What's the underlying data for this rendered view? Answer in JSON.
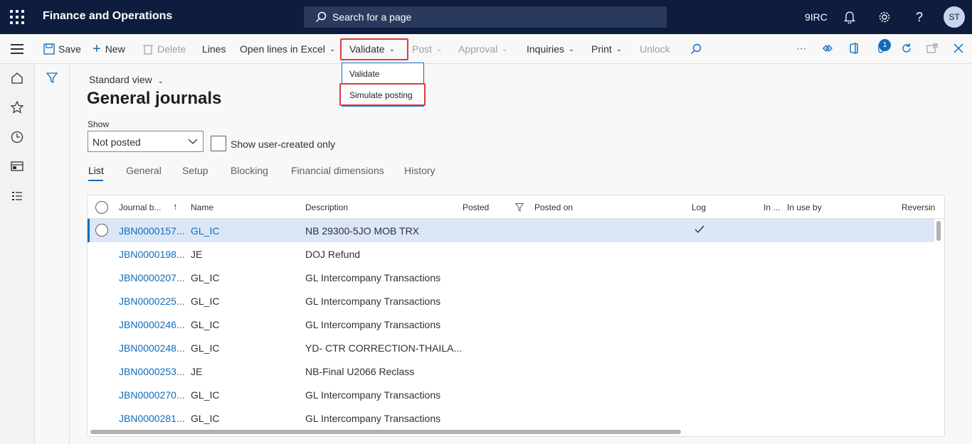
{
  "topbar": {
    "app_title": "Finance and Operations",
    "search_placeholder": "Search for a page",
    "company": "9IRC",
    "avatar_initials": "ST"
  },
  "actions": {
    "save": "Save",
    "new": "New",
    "delete": "Delete",
    "lines": "Lines",
    "open_lines_excel": "Open lines in Excel",
    "validate": "Validate",
    "post": "Post",
    "approval": "Approval",
    "inquiries": "Inquiries",
    "print": "Print",
    "unlock": "Unlock",
    "attachments_badge": "1"
  },
  "validate_menu": {
    "items": [
      "Validate",
      "Simulate posting"
    ]
  },
  "page": {
    "view_selector": "Standard view",
    "title": "General journals",
    "show_label": "Show",
    "show_value": "Not posted",
    "user_created_label": "Show user-created only"
  },
  "tabs": [
    "List",
    "General",
    "Setup",
    "Blocking",
    "Financial dimensions",
    "History"
  ],
  "grid": {
    "columns": [
      "Journal b...",
      "Name",
      "Description",
      "Posted",
      "Posted on",
      "Log",
      "In ...",
      "In use by",
      "Reversin"
    ],
    "rows": [
      {
        "journal": "JBN0000157...",
        "name": "GL_IC",
        "description": "NB 29300-5JO MOB TRX",
        "log": true
      },
      {
        "journal": "JBN0000198...",
        "name": "JE",
        "description": "DOJ Refund",
        "log": false
      },
      {
        "journal": "JBN0000207...",
        "name": "GL_IC",
        "description": "GL Intercompany Transactions",
        "log": false
      },
      {
        "journal": "JBN0000225...",
        "name": "GL_IC",
        "description": "GL Intercompany Transactions",
        "log": false
      },
      {
        "journal": "JBN0000246...",
        "name": "GL_IC",
        "description": "GL Intercompany Transactions",
        "log": false
      },
      {
        "journal": "JBN0000248...",
        "name": "GL_IC",
        "description": "YD- CTR CORRECTION-THAILA...",
        "log": false
      },
      {
        "journal": "JBN0000253...",
        "name": "JE",
        "description": "NB-Final U2066 Reclass",
        "log": false
      },
      {
        "journal": "JBN0000270...",
        "name": "GL_IC",
        "description": "GL Intercompany Transactions",
        "log": false
      },
      {
        "journal": "JBN0000281...",
        "name": "GL_IC",
        "description": "GL Intercompany Transactions",
        "log": false
      }
    ]
  }
}
